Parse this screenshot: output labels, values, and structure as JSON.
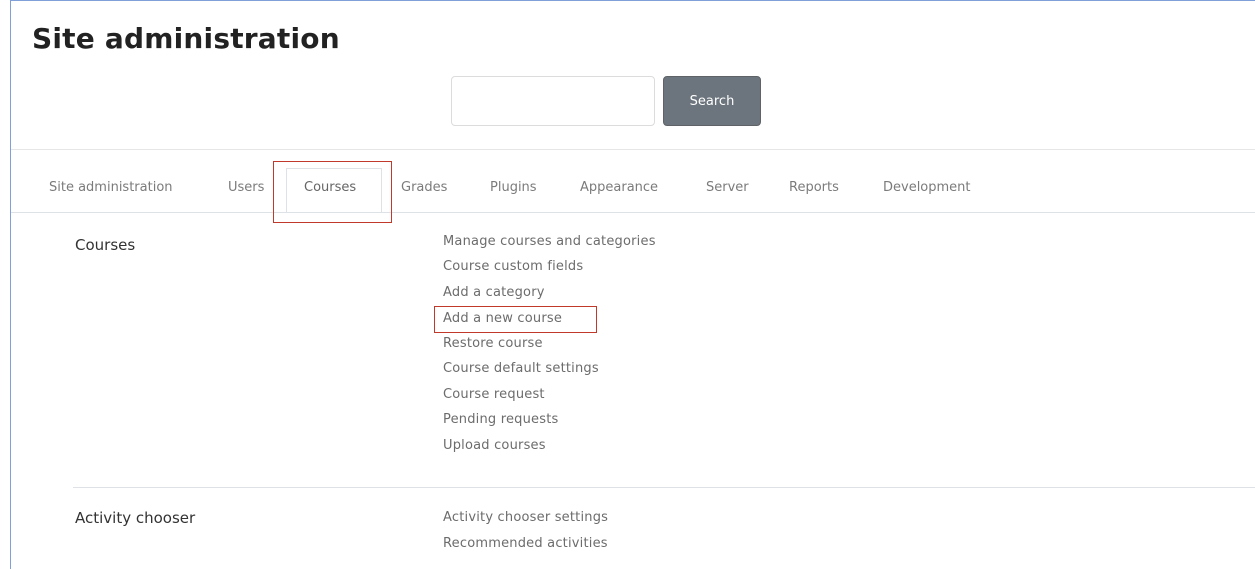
{
  "page": {
    "title": "Site administration"
  },
  "search": {
    "value": "",
    "placeholder": "",
    "button_label": "Search"
  },
  "tabs": [
    {
      "label": "Site administration",
      "active": false
    },
    {
      "label": "Users",
      "active": false
    },
    {
      "label": "Courses",
      "active": true
    },
    {
      "label": "Grades",
      "active": false
    },
    {
      "label": "Plugins",
      "active": false
    },
    {
      "label": "Appearance",
      "active": false
    },
    {
      "label": "Server",
      "active": false
    },
    {
      "label": "Reports",
      "active": false
    },
    {
      "label": "Development",
      "active": false
    }
  ],
  "sections": [
    {
      "title": "Courses",
      "links": [
        "Manage courses and categories",
        "Course custom fields",
        "Add a category",
        "Add a new course",
        "Restore course",
        "Course default settings",
        "Course request",
        "Pending requests",
        "Upload courses"
      ]
    },
    {
      "title": "Activity chooser",
      "links": [
        "Activity chooser settings",
        "Recommended activities"
      ]
    }
  ],
  "colors": {
    "highlight": "#c0392b",
    "button_bg": "#6c757d",
    "frame_border": "#7fa0d8"
  }
}
